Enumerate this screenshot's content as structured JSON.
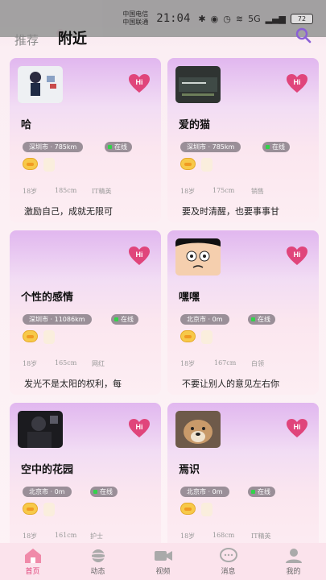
{
  "status_bar": {
    "carrier1": "中国电信",
    "carrier2": "中国联通",
    "time": "21:04",
    "network": "5G",
    "battery": "72"
  },
  "tabs": [
    {
      "label": "推荐",
      "active": false
    },
    {
      "label": "附近",
      "active": true
    }
  ],
  "colors": {
    "accent": "#e0457b",
    "card_top": "#e1b7ef",
    "online_dot": "#32d24a"
  },
  "cards": [
    {
      "name": "哈",
      "location": "深圳市 · 785km",
      "online": "在线",
      "tags": [
        "18岁",
        "185cm",
        "IT精英"
      ],
      "signature": "激励自己，成就无限可",
      "avatar": "avatar-photo-icon"
    },
    {
      "name": "爱的猫",
      "location": "深圳市 · 785km",
      "online": "在线",
      "tags": [
        "18岁",
        "175cm",
        "销售"
      ],
      "signature": "要及时清醒，也要事事甘",
      "avatar": "avatar-photo-icon"
    },
    {
      "name": "个性的感情",
      "location": "深圳市 · 11086km",
      "online": "在线",
      "tags": [
        "18岁",
        "165cm",
        "网红"
      ],
      "signature": "发光不是太阳的权利，每",
      "avatar": "avatar-blank-icon"
    },
    {
      "name": "嘿嘿",
      "location": "北京市 · 0m",
      "online": "在线",
      "tags": [
        "18岁",
        "167cm",
        "白领"
      ],
      "signature": "不要让别人的意见左右你",
      "avatar": "avatar-cartoon-icon"
    },
    {
      "name": "空中的花园",
      "location": "北京市 · 0m",
      "online": "在线",
      "tags": [
        "18岁",
        "161cm",
        "护士"
      ],
      "signature": "",
      "avatar": "avatar-photo-icon"
    },
    {
      "name": "焉识",
      "location": "北京市 · 0m",
      "online": "在线",
      "tags": [
        "18岁",
        "168cm",
        "IT精英"
      ],
      "signature": "",
      "avatar": "avatar-dog-icon"
    }
  ],
  "bottom_nav": [
    {
      "label": "首页",
      "icon": "home-icon",
      "active": true
    },
    {
      "label": "动态",
      "icon": "planet-icon",
      "active": false
    },
    {
      "label": "视频",
      "icon": "video-camera-icon",
      "active": false
    },
    {
      "label": "消息",
      "icon": "chat-bubble-icon",
      "active": false
    },
    {
      "label": "我的",
      "icon": "user-icon",
      "active": false
    }
  ]
}
